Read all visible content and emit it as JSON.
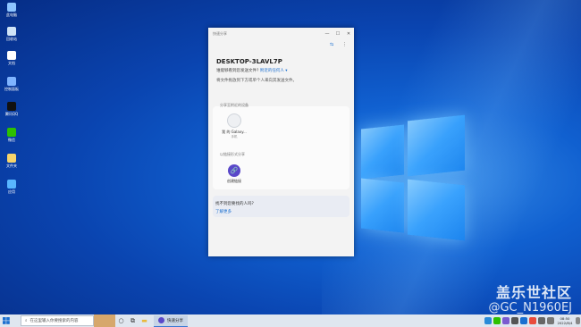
{
  "desktop": {
    "icons": [
      {
        "label": "此电脑",
        "color": "#8fc6ff"
      },
      {
        "label": "回收站",
        "color": "#cfe3f7"
      },
      {
        "label": "文档",
        "color": "#ffffff"
      },
      {
        "label": "控制面板",
        "color": "#7fb4ff"
      },
      {
        "label": "腾讯QQ",
        "color": "#111111"
      },
      {
        "label": "微信",
        "color": "#2dc100"
      },
      {
        "label": "文件夹",
        "color": "#f6d46b"
      },
      {
        "label": "应用",
        "color": "#58b6ff"
      }
    ],
    "watermark_line1": "盖乐世社区",
    "watermark_line2": "@GC_N1960EJ"
  },
  "share_window": {
    "title": "快速分享",
    "pc_name": "DESKTOP-3LAVL7P",
    "visibility_label": "谁能够看到您发送文件?",
    "visibility_value": "附近的任何人",
    "hint": "将文件拖放到下方或单个人来向其发送文件。",
    "nearby_header": "分享至附近的设备",
    "device_name": "我 的 Galaxy...",
    "device_sub": "手机",
    "other_header": "以链接形式分享",
    "link_label": "创建链接",
    "help_question": "找不到您要找的人吗?",
    "help_link": "了解更多"
  },
  "taskbar": {
    "search_placeholder": "在这里输入你要搜索的内容",
    "active_app": "快速分享",
    "time": "08:50",
    "date": "2022/8/4"
  }
}
